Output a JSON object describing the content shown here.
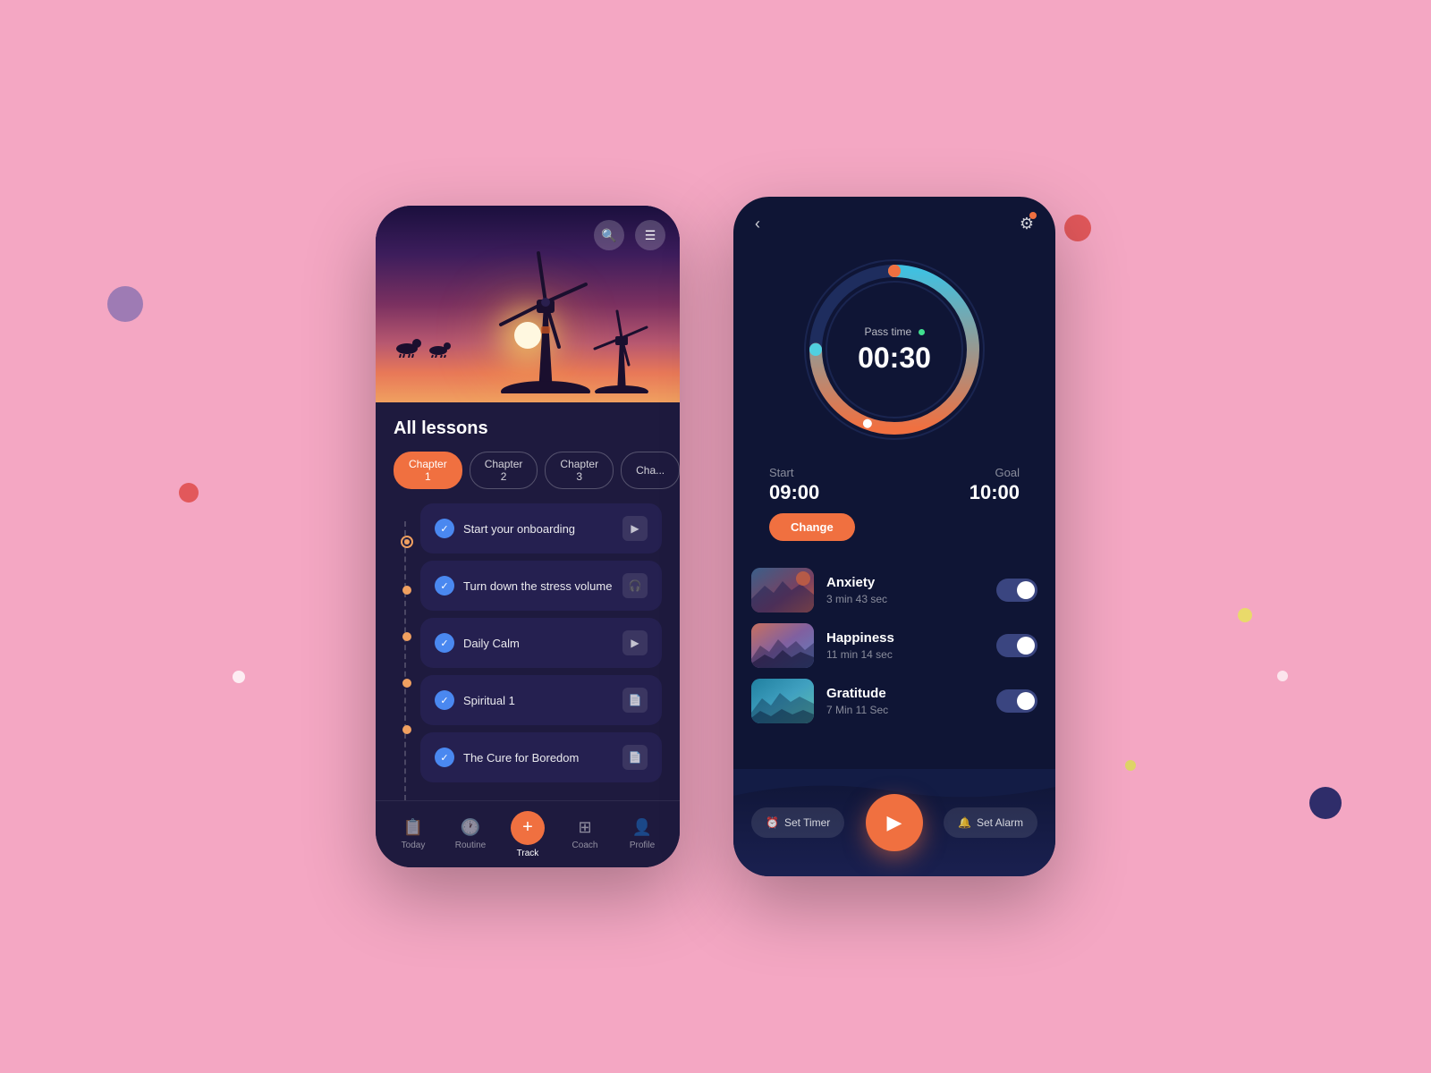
{
  "background": "#f4a7c3",
  "phone1": {
    "header": {
      "search_icon": "🔍",
      "menu_icon": "☰"
    },
    "sections": {
      "title": "All lessons",
      "chapters": [
        "Chapter 1",
        "Chapter 2",
        "Chapter 3",
        "Cha..."
      ],
      "active_chapter": 0
    },
    "lessons": [
      {
        "title": "Start your onboarding",
        "icon": "▶",
        "checked": true
      },
      {
        "title": "Turn down the stress volume",
        "icon": "🎧",
        "checked": true
      },
      {
        "title": "Daily Calm",
        "icon": "▶",
        "checked": true
      },
      {
        "title": "Spiritual 1",
        "icon": "📄",
        "checked": true
      },
      {
        "title": "The Cure for Boredom",
        "icon": "📄",
        "checked": true
      }
    ],
    "nav": [
      {
        "label": "Today",
        "icon": "📋",
        "active": false
      },
      {
        "label": "Routine",
        "icon": "🕐",
        "active": false
      },
      {
        "label": "Track",
        "icon": "+",
        "active": true
      },
      {
        "label": "Coach",
        "icon": "⊞",
        "active": false
      },
      {
        "label": "Profile",
        "icon": "👤",
        "active": false
      }
    ]
  },
  "phone2": {
    "timer": {
      "pass_time_label": "Pass time",
      "value": "00:30",
      "start_label": "Start",
      "start_value": "09:00",
      "goal_label": "Goal",
      "goal_value": "10:00",
      "change_btn": "Change"
    },
    "meditations": [
      {
        "title": "Anxiety",
        "duration": "3 min 43 sec",
        "on": true
      },
      {
        "title": "Happiness",
        "duration": "11 min 14 sec",
        "on": true
      },
      {
        "title": "Gratitude",
        "duration": "7 Min 11 Sec",
        "on": true
      }
    ],
    "footer": {
      "set_timer": "Set Timer",
      "set_alarm": "Set Alarm"
    }
  }
}
